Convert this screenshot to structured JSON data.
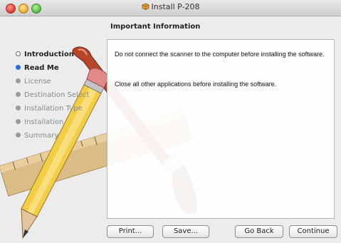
{
  "window": {
    "title": "Install P-208"
  },
  "sidebar": {
    "steps": [
      {
        "label": "Introduction",
        "state": "done"
      },
      {
        "label": "Read Me",
        "state": "current"
      },
      {
        "label": "License",
        "state": "pending"
      },
      {
        "label": "Destination Select",
        "state": "pending"
      },
      {
        "label": "Installation Type",
        "state": "pending"
      },
      {
        "label": "Installation",
        "state": "pending"
      },
      {
        "label": "Summary",
        "state": "pending"
      }
    ]
  },
  "main": {
    "heading": "Important Information",
    "paragraphs": [
      "Do not connect the scanner to the computer before installing the software.",
      "Close all other applications before installing the software."
    ]
  },
  "buttons": {
    "print": "Print...",
    "save": "Save...",
    "go_back": "Go Back",
    "continue": "Continue"
  },
  "colors": {
    "current_step": "#2a6fdb",
    "background": "#ececec"
  },
  "icons": {
    "title": "package-icon",
    "background_art": "pencil-ruler-brush-art"
  }
}
